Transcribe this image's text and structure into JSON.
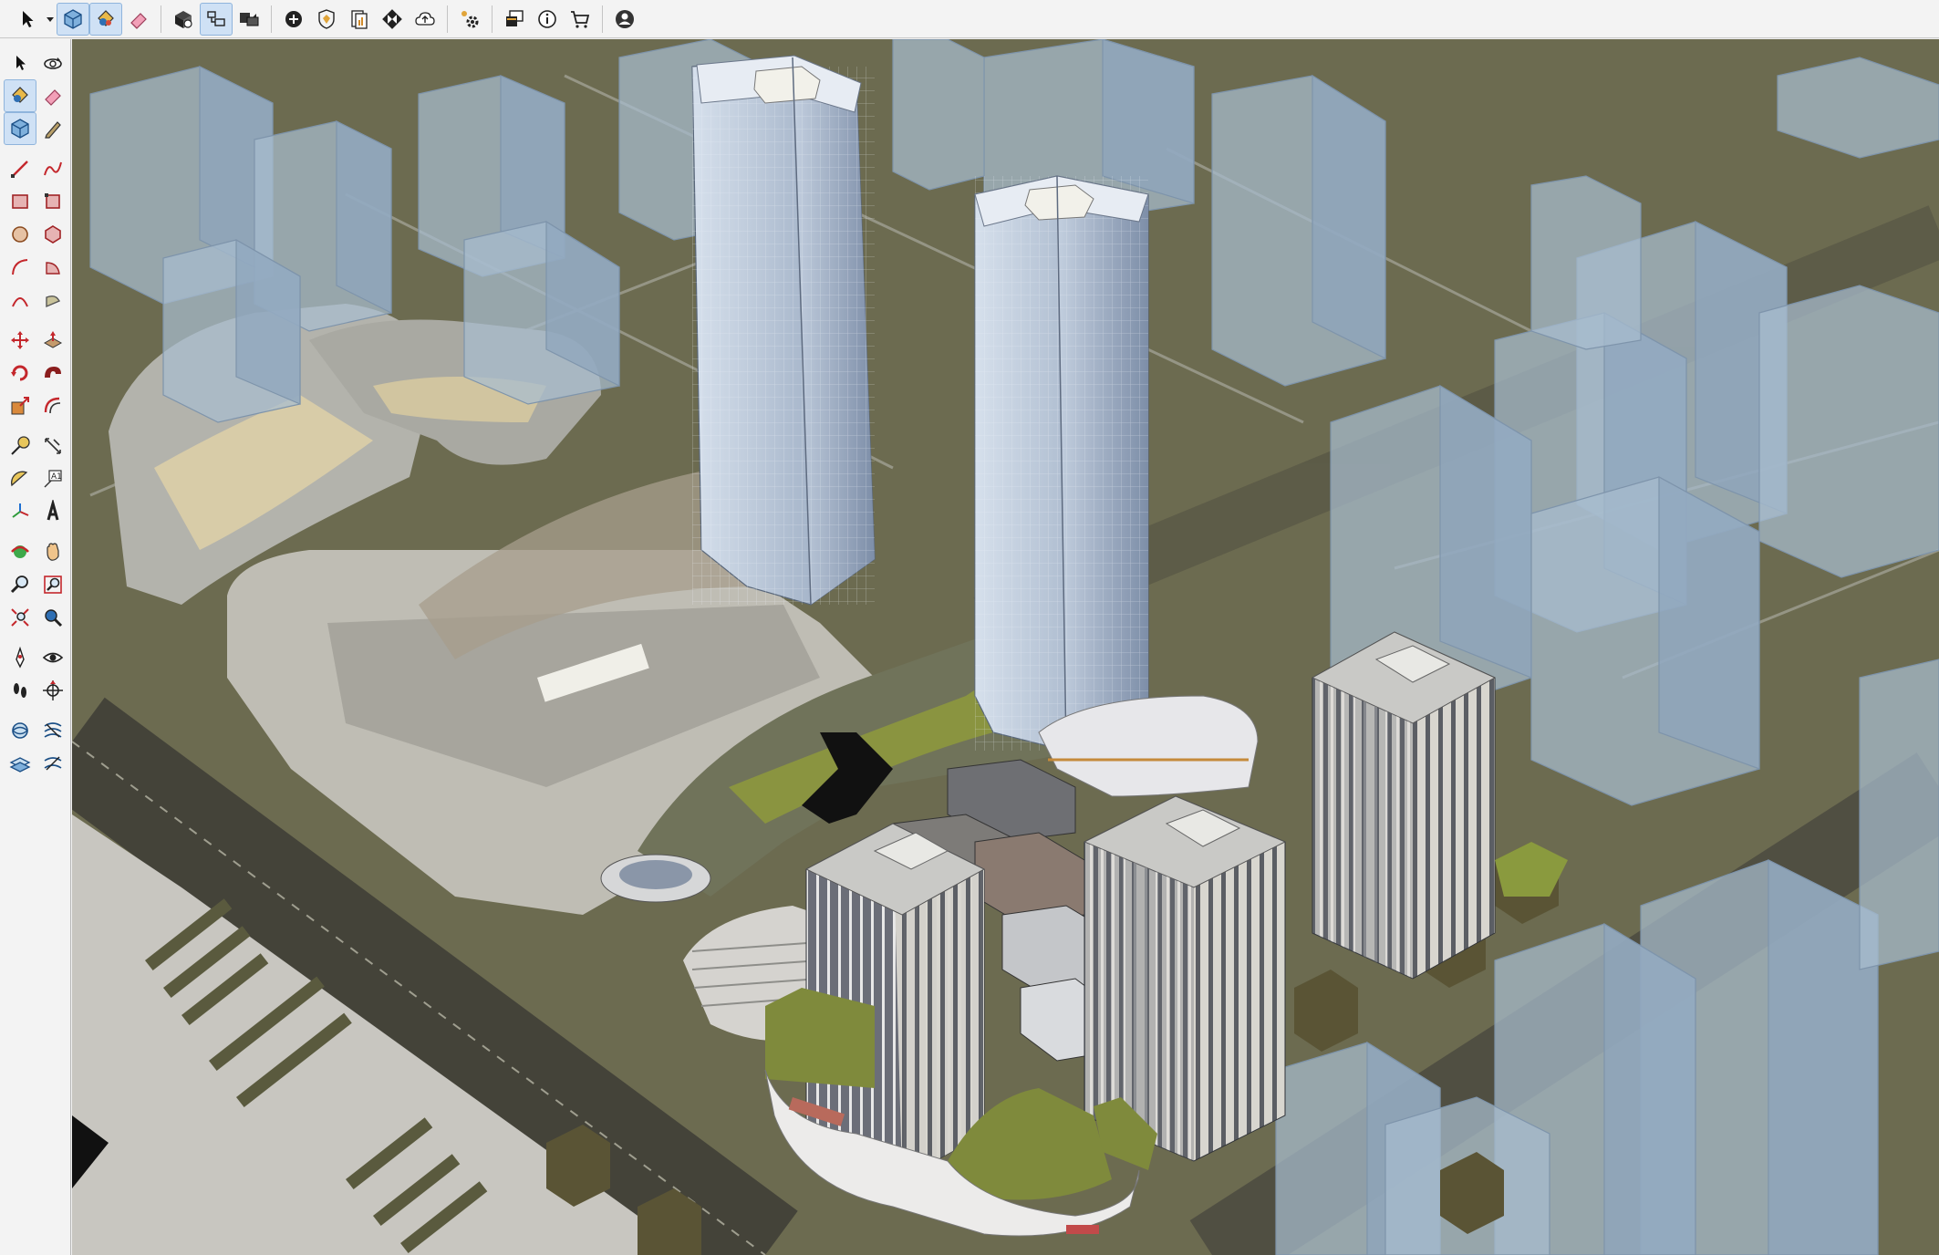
{
  "top_toolbar": {
    "icons": [
      "select-arrow-icon",
      "dropdown-caret-icon",
      "components-icon",
      "paint-bucket-icon",
      "eraser-icon",
      "extension-warehouse-icon",
      "outliner-icon",
      "scenes-icon",
      "add-location-icon",
      "shield-icon",
      "report-icon",
      "checker-icon",
      "upload-cloud-icon",
      "gear-extensions-icon",
      "window-icon",
      "info-icon",
      "cart-icon",
      "account-icon"
    ]
  },
  "left_toolbar": {
    "text_tool_label": "A1",
    "icons": [
      "select-icon",
      "orbit-icon",
      "paint-icon",
      "eraser-icon",
      "component-icon",
      "tag-pen-icon",
      "line-icon",
      "freehand-icon",
      "rectangle-icon",
      "rotated-rect-icon",
      "circle-icon",
      "polygon-icon",
      "arc-icon",
      "pie-icon",
      "two-point-arc-icon",
      "three-point-arc-icon",
      "move-icon",
      "push-pull-icon",
      "rotate-icon",
      "follow-me-icon",
      "scale-icon",
      "offset-icon",
      "tape-measure-icon",
      "dimension-icon",
      "protractor-icon",
      "text-icon",
      "axes-icon",
      "3d-text-icon",
      "orbit-tool-icon",
      "pan-icon",
      "zoom-icon",
      "zoom-window-icon",
      "zoom-extents-icon",
      "previous-view-icon",
      "position-camera-icon",
      "look-around-icon",
      "walk-icon",
      "section-plane-icon",
      "sandbox-icon",
      "sandbox-stamp-icon",
      "sandbox-drape-icon",
      "sandbox-flip-icon"
    ]
  },
  "viewport": {
    "background_color": "#6c6b50",
    "context_building_color": "#9fb5c9",
    "tower_glass_color": "#b8c7db",
    "podium_roof_green": "#7f8a3c"
  }
}
